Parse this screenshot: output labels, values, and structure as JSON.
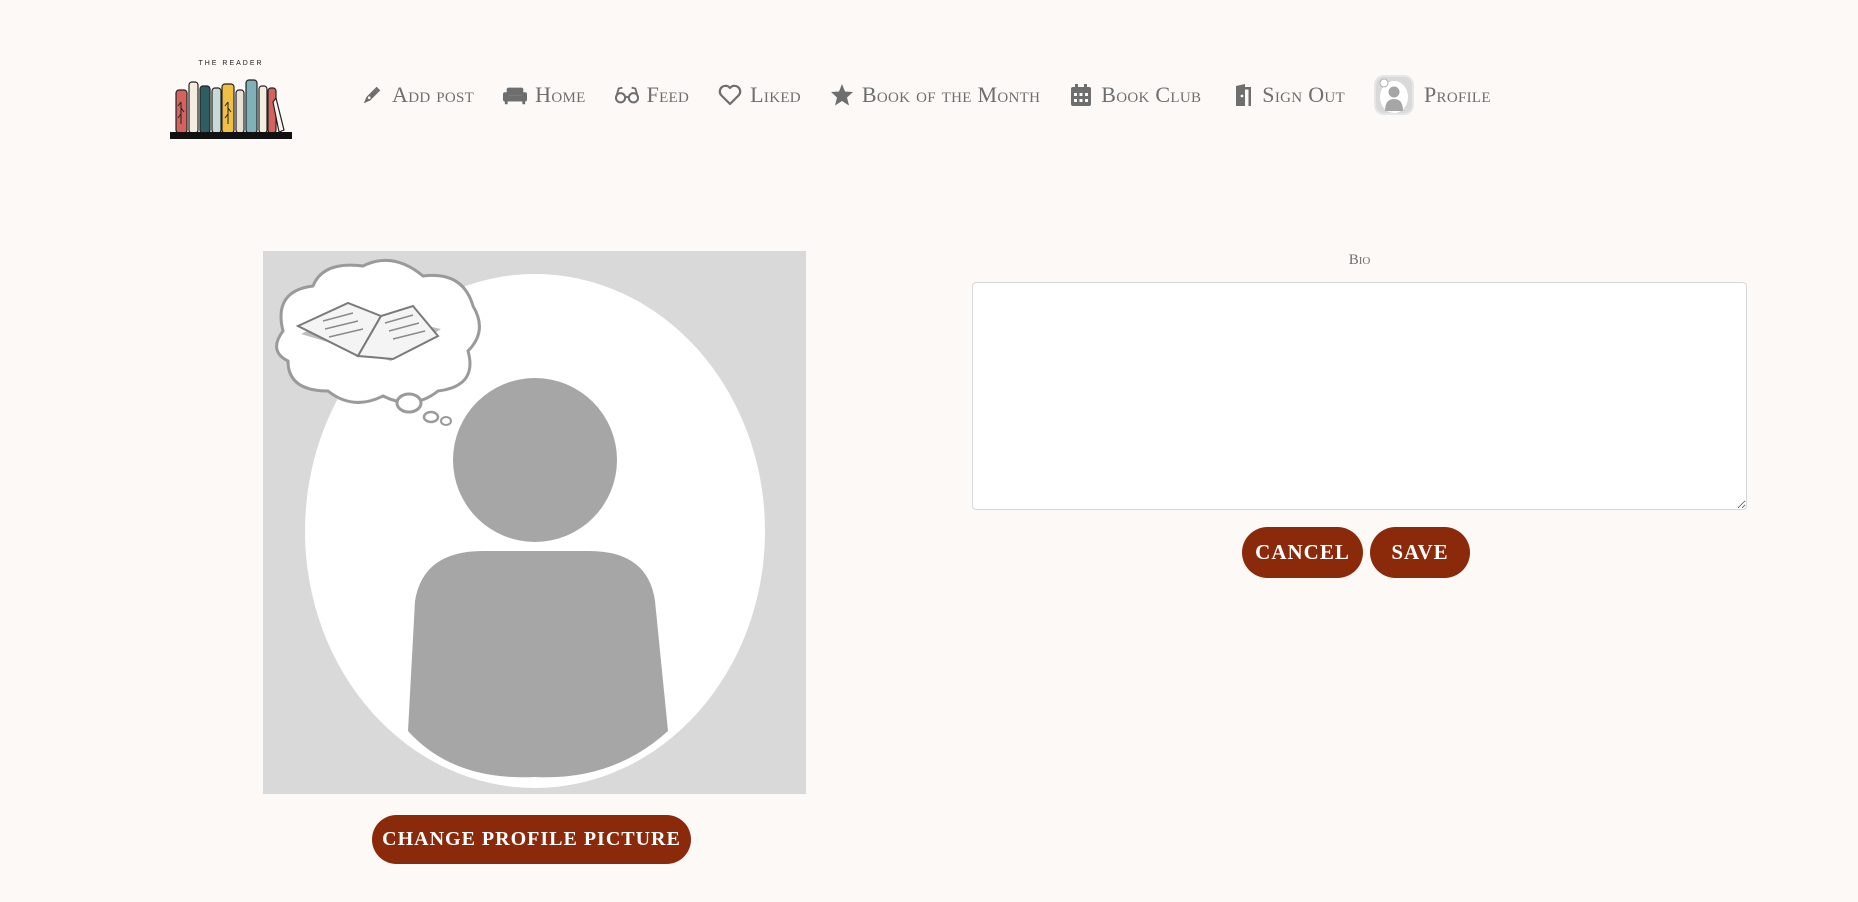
{
  "logo": {
    "text": "THE READER"
  },
  "nav": {
    "items": [
      {
        "label": "Add post",
        "icon": "pen-icon"
      },
      {
        "label": "Home",
        "icon": "sofa-icon"
      },
      {
        "label": "Feed",
        "icon": "glasses-icon"
      },
      {
        "label": "Liked",
        "icon": "heart-icon"
      },
      {
        "label": "Book of the Month",
        "icon": "star-icon"
      },
      {
        "label": "Book Club",
        "icon": "calendar-icon"
      },
      {
        "label": "Sign Out",
        "icon": "door-exit-icon"
      },
      {
        "label": "Profile",
        "icon": "avatar"
      }
    ]
  },
  "profile": {
    "change_picture_label": "CHANGE PROFILE PICTURE"
  },
  "bio": {
    "label": "Bio",
    "value": "",
    "cancel_label": "CANCEL",
    "save_label": "SAVE"
  },
  "colors": {
    "background": "#fdf9f6",
    "accent": "#8a2a0a",
    "nav_text": "#6e6e6e",
    "avatar_bg": "#d9d9d9",
    "avatar_figure": "#a6a6a6"
  }
}
